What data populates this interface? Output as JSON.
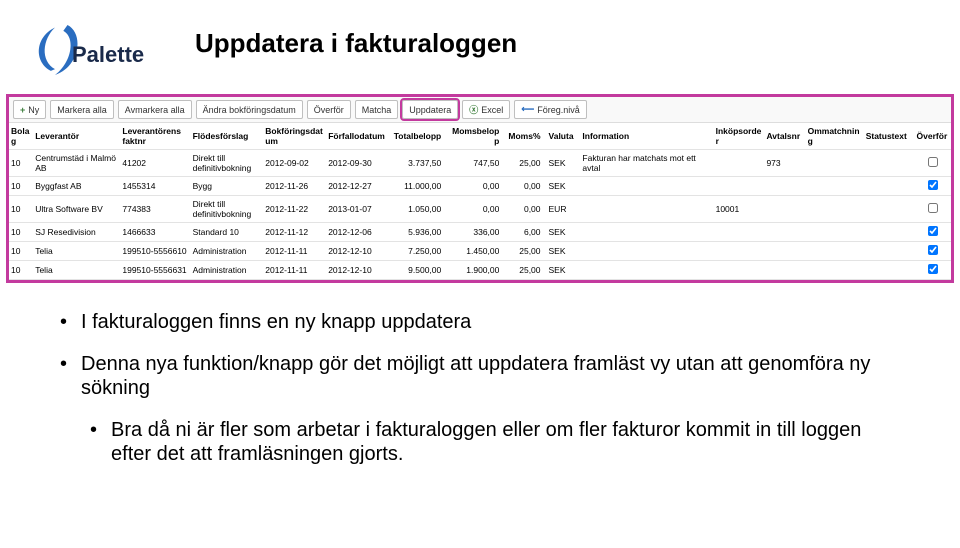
{
  "logo_text": "Palette",
  "title": "Uppdatera i fakturaloggen",
  "toolbar": {
    "ny": "Ny",
    "markera": "Markera alla",
    "avmarkera": "Avmarkera alla",
    "andra": "Ändra bokföringsdatum",
    "overfor": "Överför",
    "matcha": "Matcha",
    "uppdatera": "Uppdatera",
    "excel": "Excel",
    "foreg": "Föreg.nivå"
  },
  "headers": {
    "bolag": "Bolag",
    "leverantor": "Leverantör",
    "faktnr": "Leverantörens faktnr",
    "flodes": "Flödesförslag",
    "bokdatum": "Bokföringsdatum",
    "forfall": "Förfallodatum",
    "total": "Totalbelopp",
    "moms": "Momsbelopp",
    "momspct": "Moms%",
    "valuta": "Valuta",
    "info": "Information",
    "inkop": "Inköpsorder",
    "avtal": "Avtalsnr",
    "omm": "Ommatchning",
    "status": "Statustext",
    "overfor": "Överför"
  },
  "rows": [
    {
      "bolag": "10",
      "lev": "Centrumstäd i Malmö AB",
      "fakt": "41202",
      "flod": "Direkt till definitivbokning",
      "bok": "2012-09-02",
      "forf": "2012-09-30",
      "total": "3.737,50",
      "moms": "747,50",
      "pct": "25,00",
      "val": "SEK",
      "info": "Fakturan har matchats mot ett avtal",
      "ink": "",
      "avt": "973",
      "chk": false
    },
    {
      "bolag": "10",
      "lev": "Byggfast AB",
      "fakt": "1455314",
      "flod": "Bygg",
      "bok": "2012-11-26",
      "forf": "2012-12-27",
      "total": "11.000,00",
      "moms": "0,00",
      "pct": "0,00",
      "val": "SEK",
      "info": "",
      "ink": "",
      "avt": "",
      "chk": true
    },
    {
      "bolag": "10",
      "lev": "Ultra Software BV",
      "fakt": "774383",
      "flod": "Direkt till definitivbokning",
      "bok": "2012-11-22",
      "forf": "2013-01-07",
      "total": "1.050,00",
      "moms": "0,00",
      "pct": "0,00",
      "val": "EUR",
      "info": "",
      "ink": "10001",
      "avt": "",
      "chk": false
    },
    {
      "bolag": "10",
      "lev": "SJ Resedivision",
      "fakt": "1466633",
      "flod": "Standard 10",
      "bok": "2012-11-12",
      "forf": "2012-12-06",
      "total": "5.936,00",
      "moms": "336,00",
      "pct": "6,00",
      "val": "SEK",
      "info": "",
      "ink": "",
      "avt": "",
      "chk": true
    },
    {
      "bolag": "10",
      "lev": "Telia",
      "fakt": "199510-5556610",
      "flod": "Administration",
      "bok": "2012-11-11",
      "forf": "2012-12-10",
      "total": "7.250,00",
      "moms": "1.450,00",
      "pct": "25,00",
      "val": "SEK",
      "info": "",
      "ink": "",
      "avt": "",
      "chk": true
    },
    {
      "bolag": "10",
      "lev": "Telia",
      "fakt": "199510-5556631",
      "flod": "Administration",
      "bok": "2012-11-11",
      "forf": "2012-12-10",
      "total": "9.500,00",
      "moms": "1.900,00",
      "pct": "25,00",
      "val": "SEK",
      "info": "",
      "ink": "",
      "avt": "",
      "chk": true
    }
  ],
  "content": {
    "b1": "I fakturaloggen finns en ny knapp uppdatera",
    "b2": "Denna nya funktion/knapp gör det möjligt att uppdatera framläst vy utan att genomföra ny sökning",
    "b3": "Bra då ni är fler som arbetar i fakturaloggen eller om fler fakturor kommit in till loggen efter det att framläsningen gjorts."
  }
}
